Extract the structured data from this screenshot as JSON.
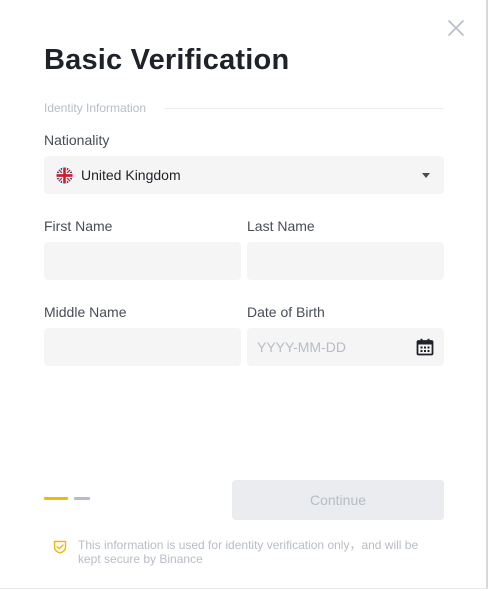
{
  "modal": {
    "title": "Basic Verification",
    "section_label": "Identity Information"
  },
  "nationality": {
    "label": "Nationality",
    "value": "United Kingdom",
    "flag_icon": "uk-flag-icon"
  },
  "fields": {
    "first_name": {
      "label": "First Name",
      "value": "",
      "placeholder": ""
    },
    "last_name": {
      "label": "Last Name",
      "value": "",
      "placeholder": ""
    },
    "middle_name": {
      "label": "Middle Name",
      "value": "",
      "placeholder": ""
    },
    "dob": {
      "label": "Date of Birth",
      "value": "",
      "placeholder": "YYYY-MM-DD"
    }
  },
  "steps": {
    "current": 1,
    "total": 2,
    "active_color": "#f0b90b",
    "inactive_color": "#b7bdc6"
  },
  "actions": {
    "continue_label": "Continue",
    "continue_disabled": true
  },
  "footer": {
    "note": "This information is used for identity verification only，and will be kept secure by Binance",
    "icon": "shield-check-icon"
  },
  "colors": {
    "brand_yellow": "#f0b90b",
    "field_bg": "#f5f5f5",
    "muted_text": "#b7bdc6"
  }
}
